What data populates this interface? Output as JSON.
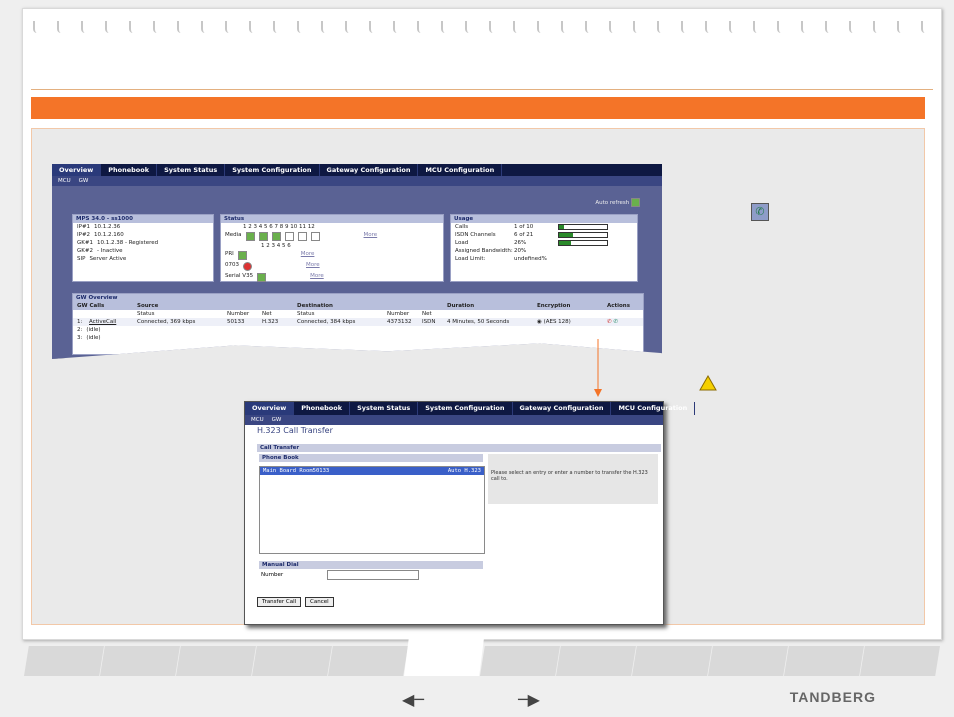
{
  "tabs": [
    "Overview",
    "Phonebook",
    "System Status",
    "System Configuration",
    "Gateway Configuration",
    "MCU Configuration"
  ],
  "subnav": [
    "MCU",
    "GW"
  ],
  "auto_refresh": "Auto refresh",
  "mps": {
    "title": "MPS 34.0 - ss1000",
    "rows": [
      {
        "k": "IP#1",
        "v": "10.1.2.36"
      },
      {
        "k": "IP#2",
        "v": "10.1.2.160"
      },
      {
        "k": "GK#1",
        "v": "10.1.2.38 - Registered"
      },
      {
        "k": "GK#2",
        "v": "- Inactive"
      },
      {
        "k": "SIP",
        "v": "Server Active"
      }
    ]
  },
  "status": {
    "title": "Status",
    "media_label": "Media",
    "cols1": "1 2 3 4 5 6 7 8 9 10 11 12",
    "cols2": "1 2 3 4 5 6",
    "pri_label": "PRI",
    "e703_label": "0703",
    "v35_label": "Serial V35",
    "more": "More"
  },
  "usage": {
    "title": "Usage",
    "calls_label": "Calls",
    "calls_val": "1 of 10",
    "calls_frac": 0.1,
    "isdn_label": "ISDN Channels",
    "isdn_val": "6 of 21",
    "isdn_frac": 0.29,
    "load_label": "Load",
    "load_val": "26%",
    "load_frac": 0.26,
    "bw_label": "Assigned Bandwidth:",
    "bw_val": "20%",
    "limit_label": "Load Limit:",
    "limit_val": "undefined%"
  },
  "gw": {
    "title": "GW Overview",
    "headers": [
      "GW Calls",
      "Source",
      "Destination",
      "Duration",
      "Encryption",
      "Actions"
    ],
    "subheaders": [
      "Status",
      "Number",
      "Net",
      "Status",
      "Number",
      "Net"
    ],
    "row1": {
      "idx": "1:",
      "name": "ActiveCall",
      "src_status": "Connected, 369 kbps",
      "src_num": "50133",
      "src_net": "H.323",
      "dst_status": "Connected, 384 kbps",
      "dst_num": "4373132",
      "dst_net": "ISDN",
      "duration": "4 Minutes, 50 Seconds",
      "enc": "(AES 128)"
    },
    "row2": {
      "idx": "2:",
      "name": "(idle)"
    },
    "row3": {
      "idx": "3:",
      "name": "(idle)"
    }
  },
  "transfer": {
    "title": "H.323 Call Transfer",
    "call_transfer": "Call Transfer",
    "phone_book": "Phone Book",
    "entry_name": "Main Board Room50133",
    "entry_type": "Auto H.323",
    "info": "Please select an entry or enter a number to transfer the H.323 call to.",
    "manual_dial": "Manual Dial",
    "number_label": "Number",
    "transfer_btn": "Transfer Call",
    "cancel_btn": "Cancel"
  },
  "brand": "TANDBERG",
  "colors": {
    "accent": "#f47428",
    "nav": "#0e1842"
  }
}
